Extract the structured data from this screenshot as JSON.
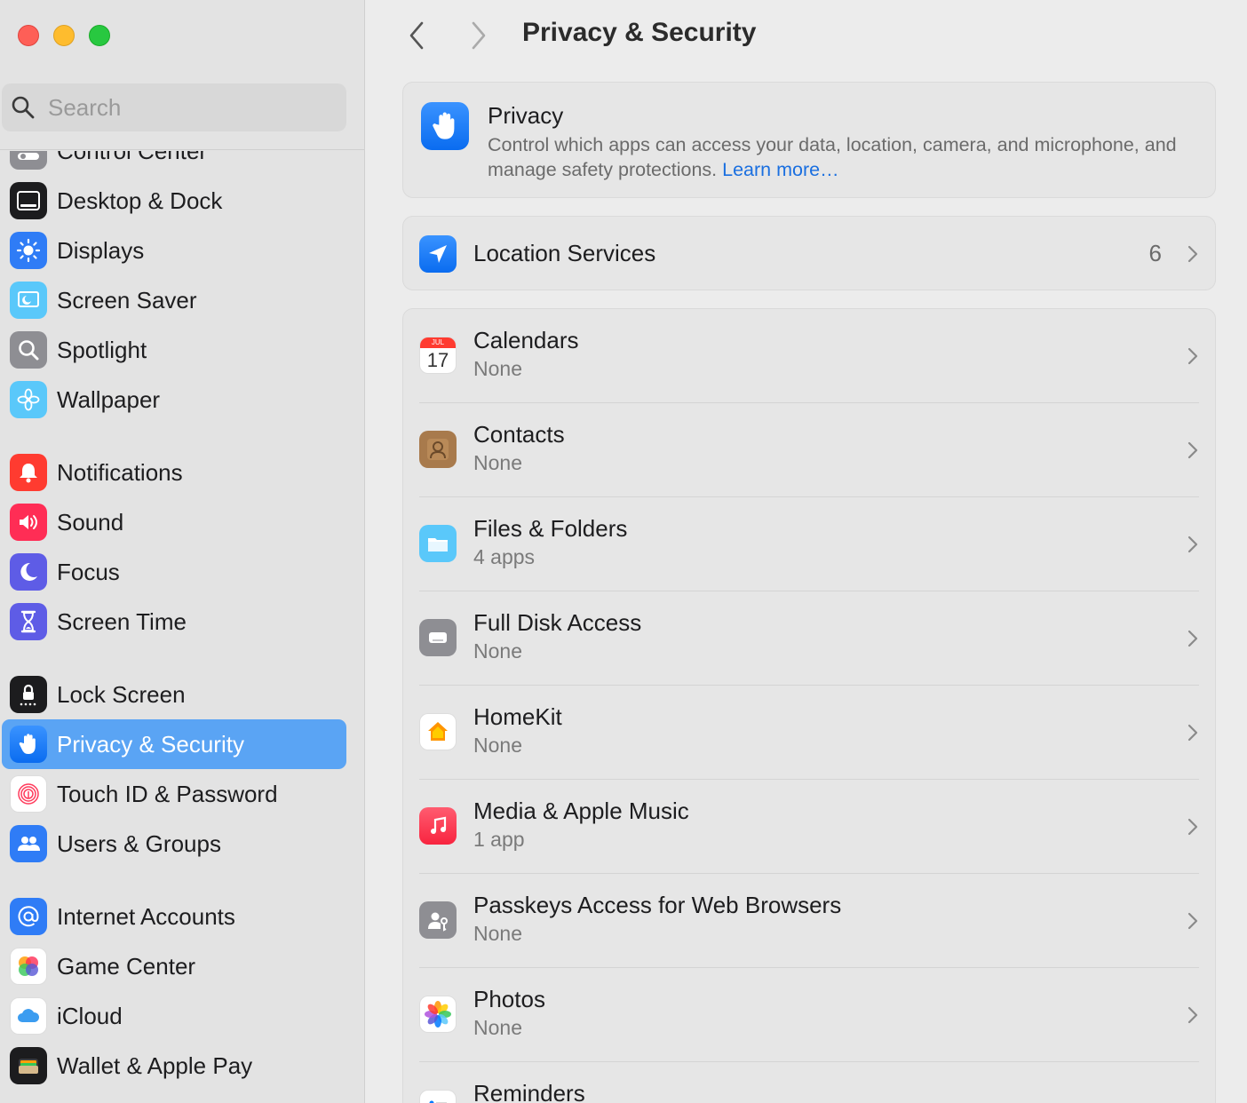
{
  "window": {
    "controls": [
      "close",
      "minimize",
      "zoom"
    ]
  },
  "sidebar": {
    "search_placeholder": "Search",
    "items": [
      {
        "label": "Control Center",
        "icon": "control-center-icon",
        "color": "#8e8e93"
      },
      {
        "label": "Desktop & Dock",
        "icon": "desktop-dock-icon",
        "color": "#1c1c1e"
      },
      {
        "label": "Displays",
        "icon": "displays-icon",
        "color": "#2f7cf6"
      },
      {
        "label": "Screen Saver",
        "icon": "screen-saver-icon",
        "color": "#5ac8fa"
      },
      {
        "label": "Spotlight",
        "icon": "spotlight-icon",
        "color": "#8e8e93"
      },
      {
        "label": "Wallpaper",
        "icon": "wallpaper-icon",
        "color": "#5ac8fa"
      },
      {
        "label": "Notifications",
        "icon": "notifications-icon",
        "color": "#ff3b30"
      },
      {
        "label": "Sound",
        "icon": "sound-icon",
        "color": "#ff2d55"
      },
      {
        "label": "Focus",
        "icon": "focus-icon",
        "color": "#5e5ce6"
      },
      {
        "label": "Screen Time",
        "icon": "screen-time-icon",
        "color": "#5e5ce6"
      },
      {
        "label": "Lock Screen",
        "icon": "lock-screen-icon",
        "color": "#1c1c1e"
      },
      {
        "label": "Privacy & Security",
        "icon": "hand-icon",
        "color": "#0a6cf0",
        "active": true
      },
      {
        "label": "Touch ID & Password",
        "icon": "fingerprint-icon",
        "color": "#ffffff"
      },
      {
        "label": "Users & Groups",
        "icon": "users-icon",
        "color": "#2f7cf6"
      },
      {
        "label": "Internet Accounts",
        "icon": "at-icon",
        "color": "#2f7cf6"
      },
      {
        "label": "Game Center",
        "icon": "game-center-icon",
        "color": "#ffffff"
      },
      {
        "label": "iCloud",
        "icon": "icloud-icon",
        "color": "#ffffff"
      },
      {
        "label": "Wallet & Apple Pay",
        "icon": "wallet-icon",
        "color": "#1c1c1e"
      }
    ]
  },
  "header": {
    "title": "Privacy & Security"
  },
  "privacy": {
    "title": "Privacy",
    "description": "Control which apps can access your data, location, camera, and microphone, and manage safety protections.",
    "link": "Learn more…"
  },
  "location": {
    "label": "Location Services",
    "count": "6"
  },
  "rows": [
    {
      "title": "Calendars",
      "subtitle": "None",
      "icon": "calendar-icon",
      "cal_month": "JUL",
      "cal_day": "17"
    },
    {
      "title": "Contacts",
      "subtitle": "None",
      "icon": "contacts-icon"
    },
    {
      "title": "Files & Folders",
      "subtitle": "4 apps",
      "icon": "folder-icon"
    },
    {
      "title": "Full Disk Access",
      "subtitle": "None",
      "icon": "disk-icon"
    },
    {
      "title": "HomeKit",
      "subtitle": "None",
      "icon": "home-icon"
    },
    {
      "title": "Media & Apple Music",
      "subtitle": "1 app",
      "icon": "music-icon"
    },
    {
      "title": "Passkeys Access for Web Browsers",
      "subtitle": "None",
      "icon": "passkeys-icon"
    },
    {
      "title": "Photos",
      "subtitle": "None",
      "icon": "photos-icon"
    },
    {
      "title": "Reminders",
      "subtitle": "",
      "icon": "reminders-icon"
    }
  ],
  "colors": {
    "accent": "#0a6cf0",
    "link": "#1a6fe0",
    "sidebar_selection": "#5aa4f4"
  }
}
